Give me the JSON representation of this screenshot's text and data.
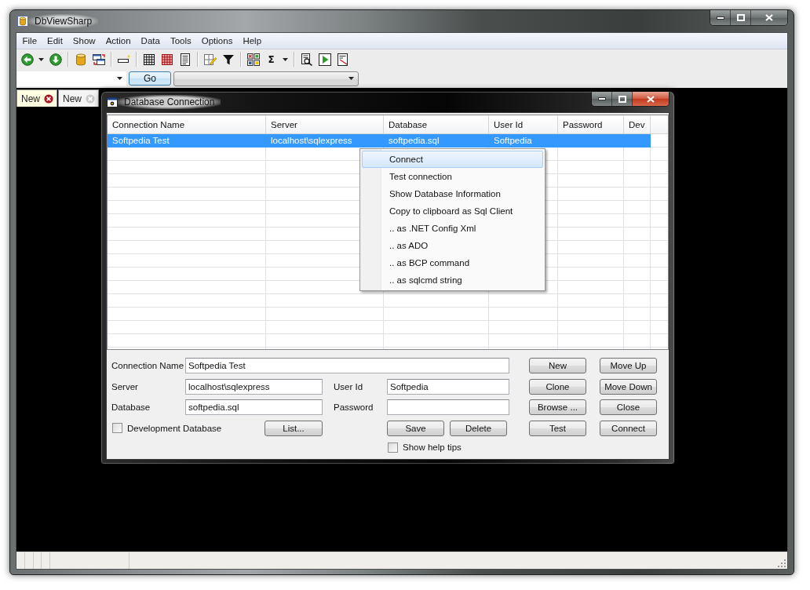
{
  "window": {
    "title": "DbViewSharp"
  },
  "menu": [
    "File",
    "Edit",
    "Show",
    "Action",
    "Data",
    "Tools",
    "Options",
    "Help"
  ],
  "toolbar": {
    "sum_button": "Σ"
  },
  "query_bar": {
    "go_button": "Go"
  },
  "tabs": [
    {
      "label": "New",
      "selected": true
    },
    {
      "label": "New",
      "selected": false
    }
  ],
  "dialog": {
    "title": "Database Connection",
    "grid": {
      "columns": [
        "Connection Name",
        "Server",
        "Database",
        "User Id",
        "Password",
        "Dev"
      ],
      "rows": [
        {
          "cells": [
            "Softpedia Test",
            "localhost\\sqlexpress",
            "softpedia.sql",
            "Softpedia"
          ],
          "selected": true
        }
      ]
    },
    "context_menu": [
      {
        "label": "Connect",
        "selected": true
      },
      {
        "label": "Test connection",
        "selected": false
      },
      {
        "label": "Show Database Information",
        "selected": false
      },
      {
        "label": "Copy to clipboard as Sql Client",
        "selected": false
      },
      {
        "label": ".. as .NET Config Xml",
        "selected": false
      },
      {
        "label": ".. as ADO",
        "selected": false
      },
      {
        "label": ".. as BCP command",
        "selected": false
      },
      {
        "label": ".. as sqlcmd string",
        "selected": false
      }
    ],
    "form": {
      "fields": [
        {
          "label": "Connection Name",
          "value": "Softpedia Test"
        },
        {
          "label": "Server",
          "value": "localhost\\sqlexpress"
        },
        {
          "label": "User Id",
          "value": "Softpedia"
        },
        {
          "label": "Database",
          "value": "softpedia.sql"
        },
        {
          "label": "Password"
        }
      ],
      "development_checkbox": {
        "label": "Development Database",
        "checked": false
      },
      "list_button": "List...",
      "save_button": "Save",
      "delete_button": "Delete",
      "help_tips_checkbox": {
        "label": "Show help tips",
        "checked": false
      }
    },
    "buttons": [
      "New",
      "Move Up",
      "Clone",
      "Move Down",
      "Browse ...",
      "Close",
      "Test",
      "Connect"
    ]
  }
}
